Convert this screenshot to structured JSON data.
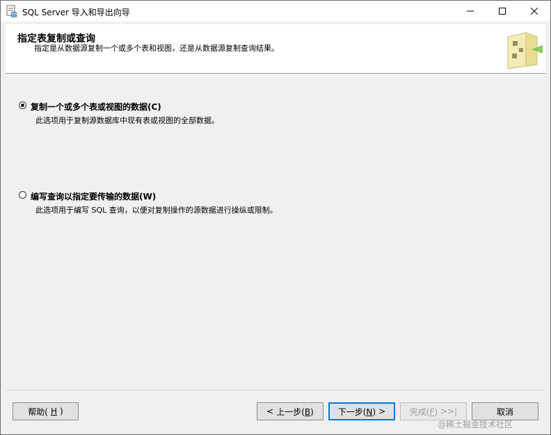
{
  "window": {
    "title": "SQL Server 导入和导出向导"
  },
  "header": {
    "title": "指定表复制或查询",
    "description": "指定是从数据源复制一个或多个表和视图，还是从数据源复制查询结果。"
  },
  "options": [
    {
      "label": "复制一个或多个表或视图的数据(C)",
      "description": "此选项用于复制源数据库中现有表或视图的全部数据。",
      "selected": true
    },
    {
      "label": "编写查询以指定要传输的数据(W)",
      "description": "此选项用于编写 SQL 查询，以便对复制操作的源数据进行操纵或限制。",
      "selected": false
    }
  ],
  "buttons": {
    "help": {
      "label": "帮助(",
      "key": "H",
      "suffix": ")"
    },
    "back": {
      "arrow": "<",
      "label": "上一步(",
      "key": "B",
      "suffix": ")"
    },
    "next": {
      "label": "下一步(",
      "key": "N",
      "suffix": ")",
      "arrow": ">"
    },
    "finish": {
      "label": "完成(",
      "key": "F",
      "suffix": ")",
      "arrow": ">>|"
    },
    "cancel": {
      "label": "取消"
    }
  },
  "watermark": "@稀土掘金技术社区",
  "colors": {
    "accent": "#0078d7",
    "window_bg": "#f0f0f0",
    "header_bg": "#ffffff"
  },
  "icons": {
    "app": "database-wizard-icon",
    "header_graphic": "wizard-banner-icon"
  }
}
